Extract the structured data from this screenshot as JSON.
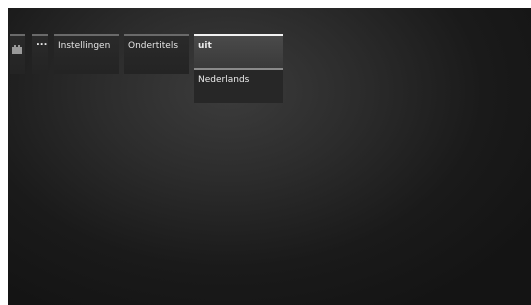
{
  "menu": {
    "more_label": "...",
    "settings_label": "Instellingen",
    "subtitles_label": "Ondertitels"
  },
  "dropdown": {
    "options": [
      {
        "label": "uit",
        "selected": true
      },
      {
        "label": "Nederlands",
        "selected": false
      }
    ]
  },
  "colors": {
    "background_center": "#3c3c3c",
    "background_edge": "#141414",
    "tile": "#262626",
    "selected_option": "#444444",
    "text": "#e6e6e6"
  },
  "icons": {
    "video": "film-icon"
  }
}
